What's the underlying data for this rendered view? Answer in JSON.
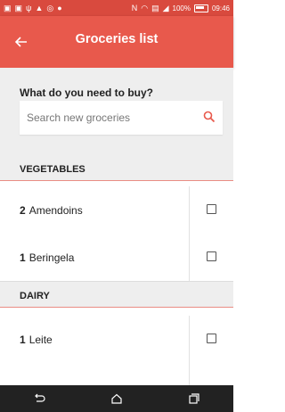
{
  "status_bar": {
    "left_icons": [
      "image-icon",
      "image-icon",
      "usb-icon",
      "alert-icon",
      "whatsapp-icon",
      "location-icon"
    ],
    "right_icons": [
      "nfc-icon",
      "wifi-icon",
      "sim-icon",
      "signal-icon"
    ],
    "battery": "100%",
    "time": "09:46"
  },
  "app_bar": {
    "title": "Groceries list",
    "back_icon": "arrow-left-icon",
    "color": "#e8594c"
  },
  "search": {
    "label": "What do you need to buy?",
    "placeholder": "Search new groceries",
    "icon": "search-icon",
    "accent": "#e8594c"
  },
  "sections": [
    {
      "title": "VEGETABLES",
      "items": [
        {
          "qty": "2",
          "name": "Amendoins"
        },
        {
          "qty": "1",
          "name": "Beringela"
        }
      ]
    },
    {
      "title": "DAIRY",
      "items": [
        {
          "qty": "1",
          "name": "Leite"
        }
      ]
    }
  ],
  "nav_bar": {
    "icons": [
      "back-icon",
      "home-icon",
      "recents-icon"
    ]
  }
}
